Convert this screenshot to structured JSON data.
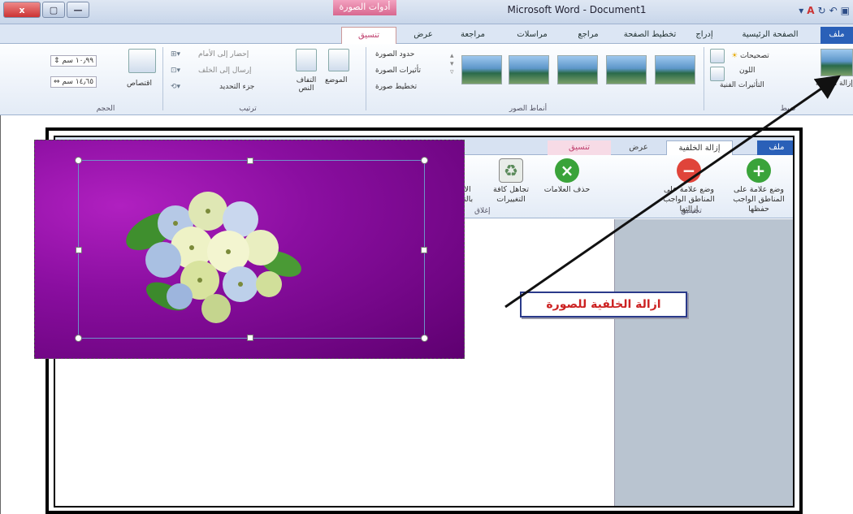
{
  "window": {
    "title": "Microsoft Word - Document1",
    "context_tools_label": "أدوات الصورة",
    "buttons": {
      "close": "x",
      "restore": "▢",
      "minimize": "—"
    }
  },
  "tabs": [
    {
      "label": "ملف"
    },
    {
      "label": "الصفحة الرئيسية"
    },
    {
      "label": "إدراج"
    },
    {
      "label": "تخطيط الصفحة"
    },
    {
      "label": "مراجع"
    },
    {
      "label": "مراسلات"
    },
    {
      "label": "مراجعة"
    },
    {
      "label": "عرض"
    },
    {
      "label": "تنسيق"
    }
  ],
  "ribbon": {
    "adjust": {
      "remove_bg": "إزالة الخلفية",
      "corrections": "تصحيحات",
      "color": "اللون",
      "artistic": "التأثيرات الفنية",
      "label": "ضبط"
    },
    "styles": {
      "border": "حدود الصورة",
      "effects": "تأثيرات الصورة",
      "layout": "تخطيط صورة",
      "label": "أنماط الصور"
    },
    "arrange": {
      "position": "الموضع",
      "wrap": "التفاف النص",
      "front": "إحضار إلى الأمام",
      "back": "إرسال إلى الخلف",
      "selection": "جزء التحديد",
      "label": "ترتيب"
    },
    "size": {
      "crop": "اقتصاص",
      "height": "١٠٫٩٩ سم",
      "width": "١٤٫٦٥ سم",
      "label": "الحجم"
    }
  },
  "inset": {
    "tabs": {
      "file": "ملف",
      "remove_bg": "إزالة الخلفية",
      "view": "عرض",
      "format": "تنسيق"
    },
    "buttons": [
      {
        "label": "وضع علامة على المناطق الواجب حفظها",
        "icon": "plus-icon",
        "color": "#3aa33a"
      },
      {
        "label": "وضع علامة على المناطق الواجب إزالتها",
        "icon": "minus-icon",
        "color": "#e0443a"
      },
      {
        "label": "حذف العلامات",
        "icon": "delete-mark-icon",
        "color": "#3aa33a"
      },
      {
        "label": "تجاهل كافة التغييرات",
        "icon": "recycle-icon",
        "color": "#6f8f6f"
      },
      {
        "label": "الاحتفاظ بالتغييرات",
        "icon": "check-icon",
        "color": "#3aa33a"
      }
    ],
    "group_refine": "تحسين",
    "group_close": "إغلاق"
  },
  "caption": "ازالة الخلفية للصورة",
  "colors": {
    "accent": "#2a60b8",
    "photo_bg": "#8a0ea0",
    "caption_text": "#cc2222"
  }
}
